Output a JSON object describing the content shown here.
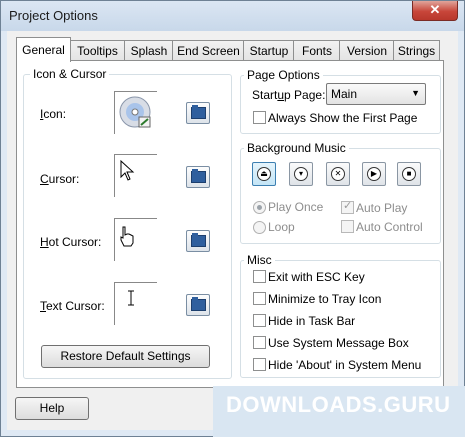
{
  "window": {
    "title": "Project Options",
    "close_glyph": "✕"
  },
  "tabs": [
    "General",
    "Tooltips",
    "Splash",
    "End Screen",
    "Startup",
    "Fonts",
    "Version",
    "Strings"
  ],
  "active_tab": "General",
  "icon_cursor": {
    "title": "Icon & Cursor",
    "icon_label_u": "I",
    "icon_label_rest": "con:",
    "cursor_label_u": "C",
    "cursor_label_rest": "ursor:",
    "hot_label_u": "H",
    "hot_label_rest": "ot Cursor:",
    "text_label_u": "T",
    "text_label_rest": "ext Cursor:",
    "restore_button": "Restore Default Settings"
  },
  "page_options": {
    "title": "Page Options",
    "startup_label_pre": "Start",
    "startup_label_u": "u",
    "startup_label_post": "p Page:",
    "startup_value": "Main",
    "always_show": "Always Show the First Page",
    "always_show_checked": false
  },
  "background_music": {
    "title": "Background Music",
    "play_once": "Play Once",
    "loop": "Loop",
    "auto_play": "Auto Play",
    "auto_control": "Auto Control",
    "auto_play_checked": true,
    "auto_control_checked": false
  },
  "misc": {
    "title": "Misc",
    "items": [
      "Exit with ESC Key",
      "Minimize to Tray Icon",
      "Hide in Task Bar",
      "Use System Message Box",
      "Hide 'About' in System Menu"
    ]
  },
  "footer": {
    "help_button": "Help"
  },
  "watermark": "DOWNLOADS.GURU"
}
